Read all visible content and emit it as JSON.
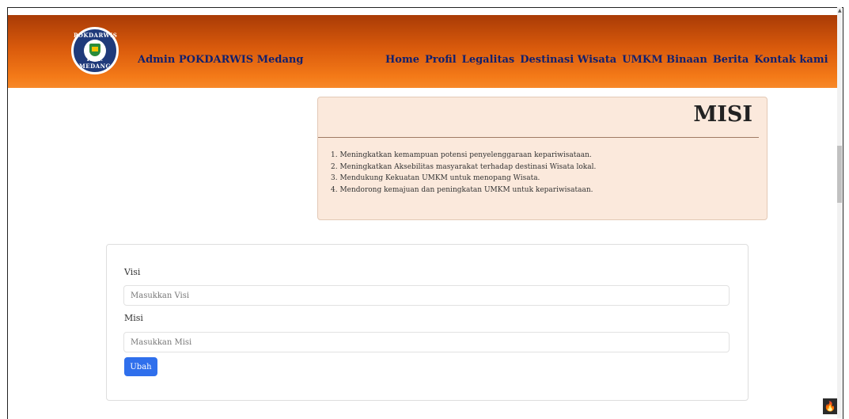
{
  "logo": {
    "top_text": "POKDARWIS",
    "bottom_text": "KEL. MEDANG"
  },
  "brand": "Admin POKDARWIS Medang",
  "nav": [
    "Home",
    "Profil",
    "Legalitas",
    "Destinasi Wisata",
    "UMKM Binaan",
    "Berita",
    "Kontak kami"
  ],
  "misi": {
    "title": "MISI",
    "items": [
      "1. Meningkatkan kemampuan potensi penyelenggaraan kepariwisataan.",
      "2. Meningkatkan Aksebilitas masyarakat terhadap destinasi Wisata lokal.",
      "3. Mendukung Kekuatan UMKM untuk menopang Wisata.",
      "4. Mendorong kemajuan dan peningkatan UMKM untuk kepariwisataan."
    ]
  },
  "form": {
    "visi_label": "Visi",
    "visi_placeholder": "Masukkan Visi",
    "misi_label": "Misi",
    "misi_placeholder": "Masukkan Misi",
    "submit_label": "Ubah"
  },
  "colors": {
    "nav_text": "#12206e",
    "button": "#2f6fec",
    "card_bg": "#fbe9dc"
  }
}
